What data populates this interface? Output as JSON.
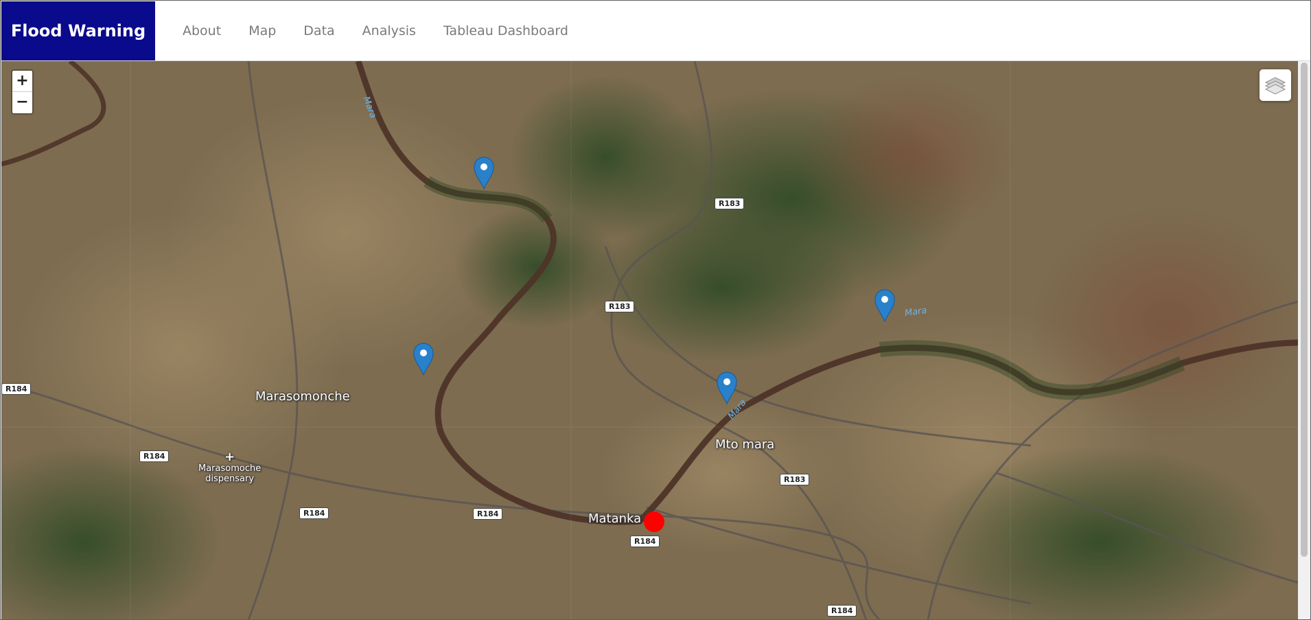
{
  "navbar": {
    "brand": "Flood Warning",
    "links": [
      "About",
      "Map",
      "Data",
      "Analysis",
      "Tableau Dashboard"
    ]
  },
  "map": {
    "zoom_in_label": "+",
    "zoom_out_label": "−",
    "layers_icon": "layers-icon",
    "places": {
      "marasomonche": "Marasomonche",
      "dispensary_line1": "Marasomoche",
      "dispensary_line2": "dispensary",
      "mto_mara": "Mto mara",
      "matanka": "Matanka"
    },
    "rivers": {
      "mara_1": "Mara",
      "mara_2": "Mara",
      "mara_3": "Mara"
    },
    "roads": {
      "r183_a": "R183",
      "r183_b": "R183",
      "r183_c": "R183",
      "r184_a": "R184",
      "r184_b": "R184",
      "r184_c": "R184",
      "r184_d": "R184",
      "r184_e": "R184",
      "r184_f": "R184"
    },
    "colors": {
      "marker": "#2a81cb",
      "alert_dot": "#ff0000",
      "river": "#5a3a2a"
    }
  }
}
